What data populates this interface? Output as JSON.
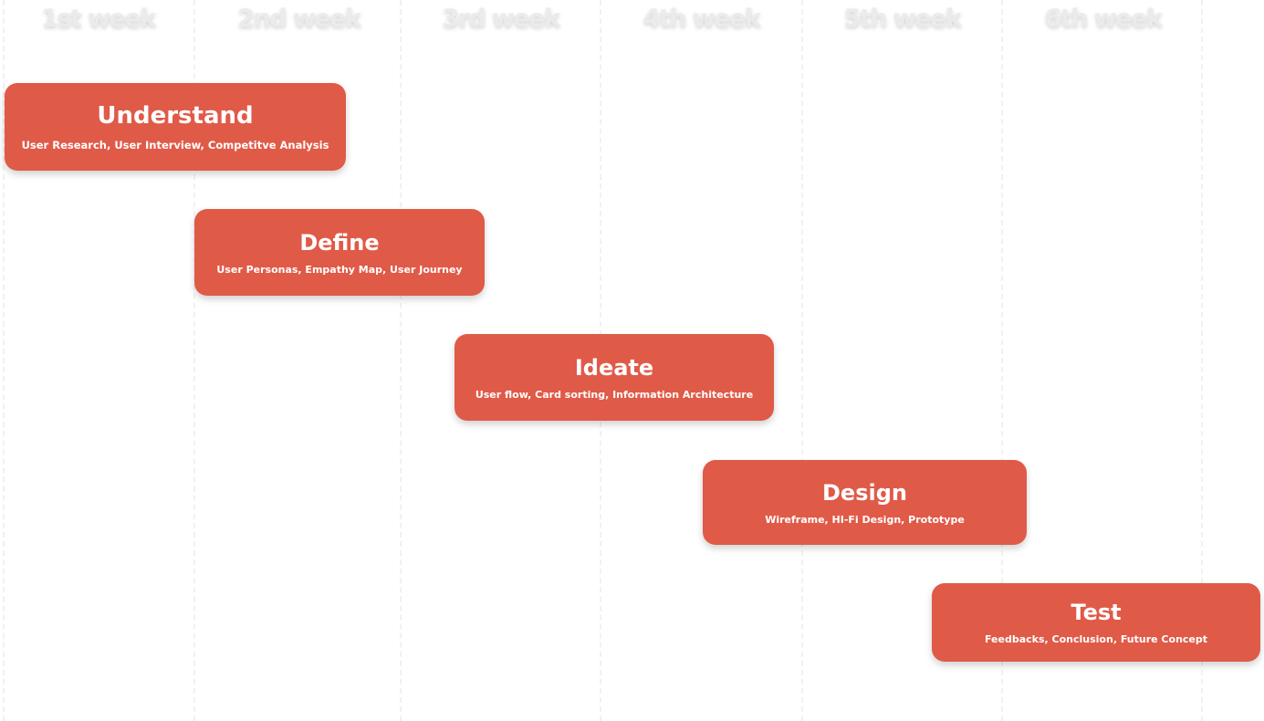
{
  "weeks": [
    {
      "label": "1st week"
    },
    {
      "label": "2nd week"
    },
    {
      "label": "3rd week"
    },
    {
      "label": "4th week"
    },
    {
      "label": "5th week"
    },
    {
      "label": "6th week"
    }
  ],
  "phases": [
    {
      "title": "Understand",
      "description": "User Research, User Interview, Competitve Analysis"
    },
    {
      "title": "Define",
      "description": "User Personas, Empathy Map, User Journey"
    },
    {
      "title": "Ideate",
      "description": "User flow, Card sorting, Information Architecture"
    },
    {
      "title": "Design",
      "description": "Wireframe, HI-Fi Design, Prototype"
    },
    {
      "title": "Test",
      "description": "Feedbacks, Conclusion, Future Concept"
    }
  ],
  "colors": {
    "phase_background": "#e05a48",
    "phase_text": "#ffffff",
    "week_label": "#ebebeb",
    "grid_line": "#f1f1f1"
  }
}
